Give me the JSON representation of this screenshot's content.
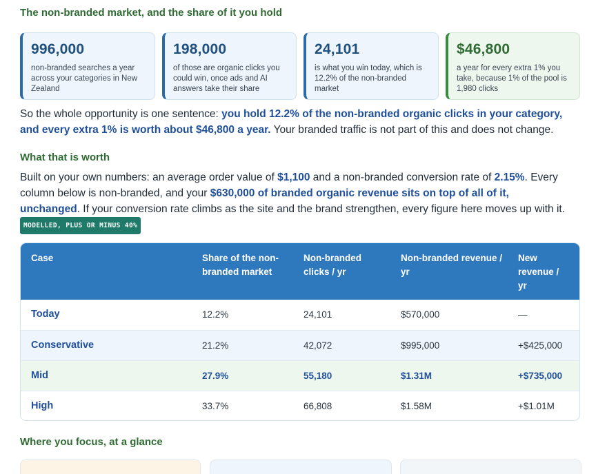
{
  "heading1": "The non-branded market, and the share of it you hold",
  "cards": [
    {
      "value": "996,000",
      "desc": "non-branded searches a year across your categories in New Zealand"
    },
    {
      "value": "198,000",
      "desc": "of those are organic clicks you could win, once ads and AI answers take their share"
    },
    {
      "value": "24,101",
      "desc": "is what you win today, which is 12.2% of the non-branded market"
    },
    {
      "value": "$46,800",
      "desc": "a year for every extra 1% you take, because 1% of the pool is 1,980 clicks"
    }
  ],
  "summary": {
    "pre": "So the whole opportunity is one sentence: ",
    "bold": "you hold 12.2% of the non-branded organic clicks in your category, and every extra 1% is worth about $46,800 a year.",
    "post": " Your branded traffic is not part of this and does not change."
  },
  "heading2": "What that is worth",
  "worth": {
    "t1": "Built on your own numbers: an average order value of ",
    "b1": "$1,100",
    "t2": " and a non-branded conversion rate of ",
    "b2": "2.15%",
    "t3": ". Every column below is non-branded, and your ",
    "b3": "$630,000 of branded organic revenue sits on top of all of it, unchanged",
    "t4": ". If your conversion rate climbs as the site and the brand strengthen, every figure here moves up with it. ",
    "tag": "MODELLED, PLUS OR MINUS 40%"
  },
  "table": {
    "headers": [
      "Case",
      "Share of the non-branded market",
      "Non-branded clicks / yr",
      "Non-branded revenue / yr",
      "New revenue / yr"
    ],
    "rows": [
      {
        "case": "Today",
        "share": "12.2%",
        "clicks": "24,101",
        "revenue": "$570,000",
        "new": "—"
      },
      {
        "case": "Conservative",
        "share": "21.2%",
        "clicks": "42,072",
        "revenue": "$995,000",
        "new": "+$425,000"
      },
      {
        "case": "Mid",
        "share": "27.9%",
        "clicks": "55,180",
        "revenue": "$1.31M",
        "new": "+$735,000"
      },
      {
        "case": "High",
        "share": "33.7%",
        "clicks": "66,808",
        "revenue": "$1.58M",
        "new": "+$1.01M"
      }
    ]
  },
  "heading3": "Where you focus, at a glance",
  "colors": {
    "row_highlight": "#eef7ee",
    "row_alt": "#eef5fc",
    "header_bg": "#2e78be"
  }
}
